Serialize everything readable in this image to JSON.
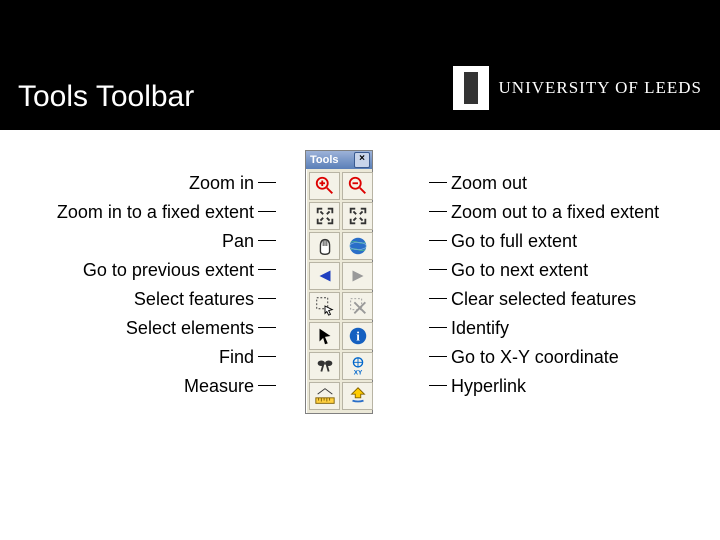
{
  "header": {
    "title": "Tools Toolbar",
    "university": "UNIVERSITY OF LEEDS"
  },
  "toolbar": {
    "title": "Tools",
    "close_x": "×",
    "buttons": [
      {
        "name": "zoom-in-icon"
      },
      {
        "name": "zoom-out-icon"
      },
      {
        "name": "fixed-zoom-in-icon"
      },
      {
        "name": "fixed-zoom-out-icon"
      },
      {
        "name": "pan-icon"
      },
      {
        "name": "full-extent-icon"
      },
      {
        "name": "prev-extent-icon"
      },
      {
        "name": "next-extent-icon"
      },
      {
        "name": "select-features-icon"
      },
      {
        "name": "clear-selection-icon"
      },
      {
        "name": "select-elements-icon"
      },
      {
        "name": "identify-icon"
      },
      {
        "name": "find-icon"
      },
      {
        "name": "goto-xy-icon"
      },
      {
        "name": "measure-icon"
      },
      {
        "name": "hyperlink-icon"
      }
    ]
  },
  "left_labels": [
    "Zoom in",
    "Zoom in to a fixed extent",
    "Pan",
    "Go to previous extent",
    "Select features",
    "Select elements",
    "Find",
    "Measure"
  ],
  "right_labels": [
    "Zoom out",
    "Zoom out to a fixed extent",
    "Go to full extent",
    "Go to next extent",
    "Clear selected features",
    "Identify",
    "Go to X-Y coordinate",
    "Hyperlink"
  ]
}
